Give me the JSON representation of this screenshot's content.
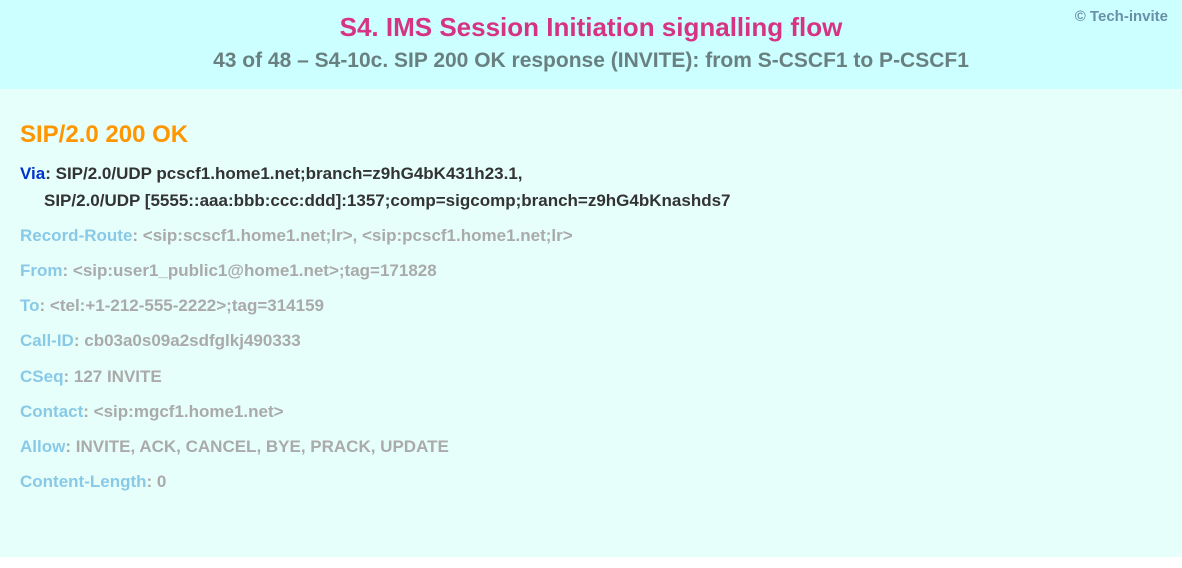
{
  "copyright": "© Tech-invite",
  "title": "S4. IMS Session Initiation signalling flow",
  "subtitle": "43 of 48 – S4-10c. SIP 200 OK response (INVITE): from S-CSCF1 to P-CSCF1",
  "statusLine": "SIP/2.0 200 OK",
  "headers": [
    {
      "name": "Via",
      "value": "SIP/2.0/UDP pcscf1.home1.net;branch=z9hG4bK431h23.1,",
      "style": "bright",
      "continuation": "SIP/2.0/UDP [5555::aaa:bbb:ccc:ddd]:1357;comp=sigcomp;branch=z9hG4bKnashds7"
    },
    {
      "name": "Record-Route",
      "value": "<sip:scscf1.home1.net;lr>, <sip:pcscf1.home1.net;lr>",
      "style": "dim"
    },
    {
      "name": "From",
      "value": "<sip:user1_public1@home1.net>;tag=171828",
      "style": "dim"
    },
    {
      "name": "To",
      "value": "<tel:+1-212-555-2222>;tag=314159",
      "style": "dim"
    },
    {
      "name": "Call-ID",
      "value": "cb03a0s09a2sdfglkj490333",
      "style": "dim"
    },
    {
      "name": "CSeq",
      "value": "127 INVITE",
      "style": "dim"
    },
    {
      "name": "Contact",
      "value": "<sip:mgcf1.home1.net>",
      "style": "dim"
    },
    {
      "name": "Allow",
      "value": "INVITE, ACK, CANCEL, BYE, PRACK, UPDATE",
      "style": "dim"
    },
    {
      "name": "Content-Length",
      "value": "0",
      "style": "dim"
    }
  ]
}
